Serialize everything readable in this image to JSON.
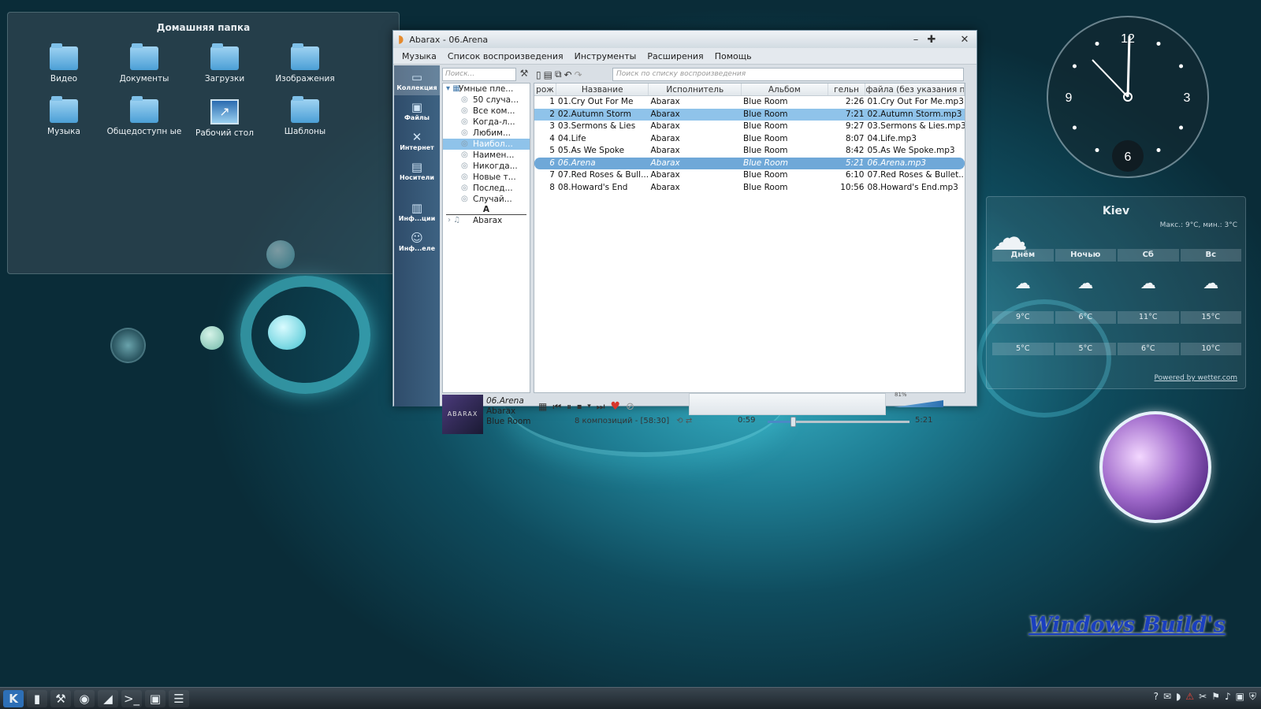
{
  "desktop": {
    "folder_view_title": "Домашняя папка",
    "icons": [
      {
        "label": "Видео",
        "icon": "folder-icon"
      },
      {
        "label": "Документы",
        "icon": "folder-icon"
      },
      {
        "label": "Загрузки",
        "icon": "folder-icon"
      },
      {
        "label": "Изображения",
        "icon": "folder-icon"
      },
      {
        "label": "Музыка",
        "icon": "folder-icon"
      },
      {
        "label": "Общедоступн ые",
        "icon": "folder-icon"
      },
      {
        "label": "Рабочий стол",
        "icon": "desktop-icon"
      },
      {
        "label": "Шаблоны",
        "icon": "folder-icon"
      }
    ],
    "watermark": "Windows Build's"
  },
  "player": {
    "title": "Abarax - 06.Arena",
    "menu": [
      "Музыка",
      "Список воспроизведения",
      "Инструменты",
      "Расширения",
      "Помощь"
    ],
    "sidebar": [
      {
        "label": "Коллекция",
        "icon": "collection-icon",
        "active": true
      },
      {
        "label": "Файлы",
        "icon": "files-icon"
      },
      {
        "label": "Интернет",
        "icon": "internet-icon"
      },
      {
        "label": "Носители",
        "icon": "media-icon"
      },
      {
        "label": "Инф...ции",
        "icon": "info-icon"
      },
      {
        "label": "Инф...еле",
        "icon": "user-icon"
      }
    ],
    "collection_search_placeholder": "Поиск...",
    "playlist_search_placeholder": "Поиск по списку воспроизведения",
    "tree": {
      "root": "Умные пле...",
      "items": [
        "50 случа...",
        "Все ком...",
        "Когда-л...",
        "Любим...",
        "Наибол...",
        "Наимен...",
        "Никогда...",
        "Новые т...",
        "Послед...",
        "Случай..."
      ],
      "selected_index": 4,
      "separator": "A",
      "artist": "Abarax"
    },
    "columns": [
      "рож",
      "Название",
      "Исполнитель",
      "Альбом",
      "гельн",
      "файла (без указания п"
    ],
    "tracks": [
      {
        "n": "1",
        "title": "01.Cry Out For Me",
        "artist": "Abarax",
        "album": "Blue Room",
        "dur": "2:26",
        "file": "01.Cry Out For Me.mp3"
      },
      {
        "n": "2",
        "title": "02.Autumn Storm",
        "artist": "Abarax",
        "album": "Blue Room",
        "dur": "7:21",
        "file": "02.Autumn Storm.mp3"
      },
      {
        "n": "3",
        "title": "03.Sermons & Lies",
        "artist": "Abarax",
        "album": "Blue Room",
        "dur": "9:27",
        "file": "03.Sermons & Lies.mp3"
      },
      {
        "n": "4",
        "title": "04.Life",
        "artist": "Abarax",
        "album": "Blue Room",
        "dur": "8:07",
        "file": "04.Life.mp3"
      },
      {
        "n": "5",
        "title": "05.As We Spoke",
        "artist": "Abarax",
        "album": "Blue Room",
        "dur": "8:42",
        "file": "05.As We Spoke.mp3"
      },
      {
        "n": "6",
        "title": "06.Arena",
        "artist": "Abarax",
        "album": "Blue Room",
        "dur": "5:21",
        "file": "06.Arena.mp3"
      },
      {
        "n": "7",
        "title": "07.Red Roses & Bull...",
        "artist": "Abarax",
        "album": "Blue Room",
        "dur": "6:10",
        "file": "07.Red Roses & Bullet..."
      },
      {
        "n": "8",
        "title": "08.Howard's End",
        "artist": "Abarax",
        "album": "Blue Room",
        "dur": "10:56",
        "file": "08.Howard's End.mp3"
      }
    ],
    "selected_track_index": 1,
    "playing_track_index": 5,
    "now_playing": {
      "title": "06.Arena",
      "artist": "Abarax",
      "album": "Blue Room",
      "art_text": "ABARAX"
    },
    "status": "8 композиций - [58:30]",
    "time_elapsed": "0:59",
    "time_total": "5:21",
    "progress_fraction": 0.18,
    "volume_label": "81%",
    "volume_fraction": 0.81
  },
  "clock": {
    "numerals": [
      "12",
      "3",
      "6",
      "9"
    ]
  },
  "weather": {
    "city": "Kiev",
    "maxmin": "Макс.: 9°C, мин.: 3°C",
    "days": [
      "Днём",
      "Ночью",
      "Сб",
      "Вс"
    ],
    "high": [
      "9°C",
      "6°C",
      "11°C",
      "15°C"
    ],
    "low": [
      "5°C",
      "5°C",
      "6°C",
      "10°C"
    ],
    "powered": "Powered by wetter.com"
  },
  "taskbar": {
    "launchers": [
      "kde-menu-icon",
      "files-icon",
      "settings-icon",
      "browser-icon",
      "player-icon",
      "terminal-icon",
      "image-icon",
      "taskmanager-icon"
    ],
    "tray": [
      "help-icon",
      "mail-icon",
      "player-tray-icon",
      "warning-icon",
      "scissors-icon",
      "flag-icon",
      "volume-icon",
      "network-icon",
      "shield-icon"
    ]
  },
  "colors": {
    "selection": "#8fc3ea",
    "playing": "#6fa8d8",
    "accent": "#2c6fb0"
  }
}
